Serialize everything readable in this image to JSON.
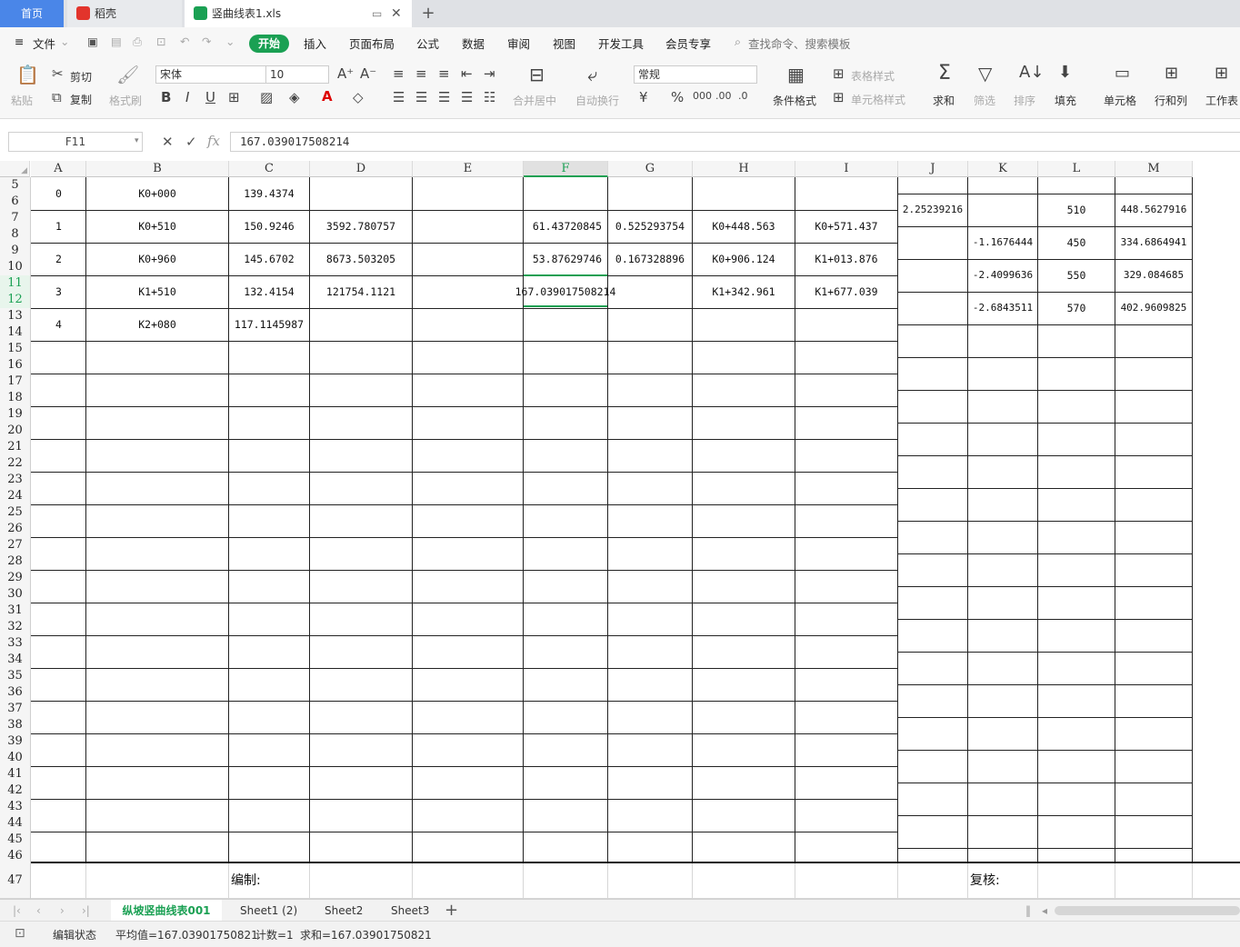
{
  "tabs": {
    "home": "首页",
    "daoke": "稻壳",
    "file": "竖曲线表1.xls"
  },
  "menu": {
    "file": "文件",
    "start": "开始",
    "insert": "插入",
    "layout": "页面布局",
    "formula": "公式",
    "data": "数据",
    "review": "审阅",
    "view": "视图",
    "dev": "开发工具",
    "member": "会员专享",
    "search": "查找命令、搜索模板"
  },
  "ribbon": {
    "paste": "粘贴",
    "cut": "剪切",
    "copy": "复制",
    "format_painter": "格式刷",
    "font": "宋体",
    "size": "10",
    "merge": "合并居中",
    "wrap": "自动换行",
    "number_format": "常规",
    "cond_format": "条件格式",
    "table_style": "表格样式",
    "cell_style": "单元格样式",
    "sum": "求和",
    "filter": "筛选",
    "sort": "排序",
    "fill": "填充",
    "cell": "单元格",
    "rowcol": "行和列",
    "worksheet": "工作表"
  },
  "formula_bar": {
    "name_box": "F11",
    "value": "167.039017508214"
  },
  "columns": [
    "A",
    "B",
    "C",
    "D",
    "E",
    "F",
    "G",
    "H",
    "I",
    "J",
    "K",
    "L",
    "M"
  ],
  "rows": [
    "5",
    "6",
    "7",
    "8",
    "9",
    "10",
    "11",
    "12",
    "13",
    "14",
    "15",
    "16",
    "17",
    "18",
    "19",
    "20",
    "21",
    "22",
    "23",
    "24",
    "25",
    "26",
    "27",
    "28",
    "29",
    "30",
    "31",
    "32",
    "33",
    "34",
    "35",
    "36",
    "37",
    "38",
    "39",
    "40",
    "41",
    "42",
    "43",
    "44",
    "45",
    "46",
    "47"
  ],
  "table": [
    {
      "a": "0",
      "b": "K0+000",
      "c": "139.4374",
      "d": "",
      "f": "",
      "g": "",
      "h": "",
      "i": ""
    },
    {
      "a": "1",
      "b": "K0+510",
      "c": "150.9246",
      "d": "3592.780757",
      "f": "61.43720845",
      "g": "0.525293754",
      "h": "K0+448.563",
      "i": "K0+571.437"
    },
    {
      "a": "2",
      "b": "K0+960",
      "c": "145.6702",
      "d": "8673.503205",
      "f": "53.87629746",
      "g": "0.167328896",
      "h": "K0+906.124",
      "i": "K1+013.876"
    },
    {
      "a": "3",
      "b": "K1+510",
      "c": "132.4154",
      "d": "121754.1121",
      "f": "167.039017508214",
      "g": "",
      "h": "K1+342.961",
      "i": "K1+677.039"
    },
    {
      "a": "4",
      "b": "K2+080",
      "c": "117.1145987",
      "d": "",
      "f": "",
      "g": "",
      "h": "",
      "i": ""
    }
  ],
  "right_table": [
    {
      "j": "2.25239216",
      "k": "",
      "l": "510",
      "m": "448.5627916"
    },
    {
      "j": "",
      "k": "-1.1676444",
      "l": "450",
      "m": "334.6864941"
    },
    {
      "j": "",
      "k": "-2.4099636",
      "l": "550",
      "m": "329.084685"
    },
    {
      "j": "",
      "k": "-2.6843511",
      "l": "570",
      "m": "402.9609825"
    }
  ],
  "footer": {
    "editor": "编制:",
    "reviewer": "复核:"
  },
  "sheets": [
    "纵坡竖曲线表001",
    "Sheet1 (2)",
    "Sheet2",
    "Sheet3"
  ],
  "status": {
    "mode": "编辑状态",
    "avg": "平均值=167.03901750821",
    "count": "计数=1",
    "sum": "求和=167.03901750821"
  },
  "colors": {
    "accent": "#1aa053",
    "tab_blue": "#4a86e8"
  }
}
